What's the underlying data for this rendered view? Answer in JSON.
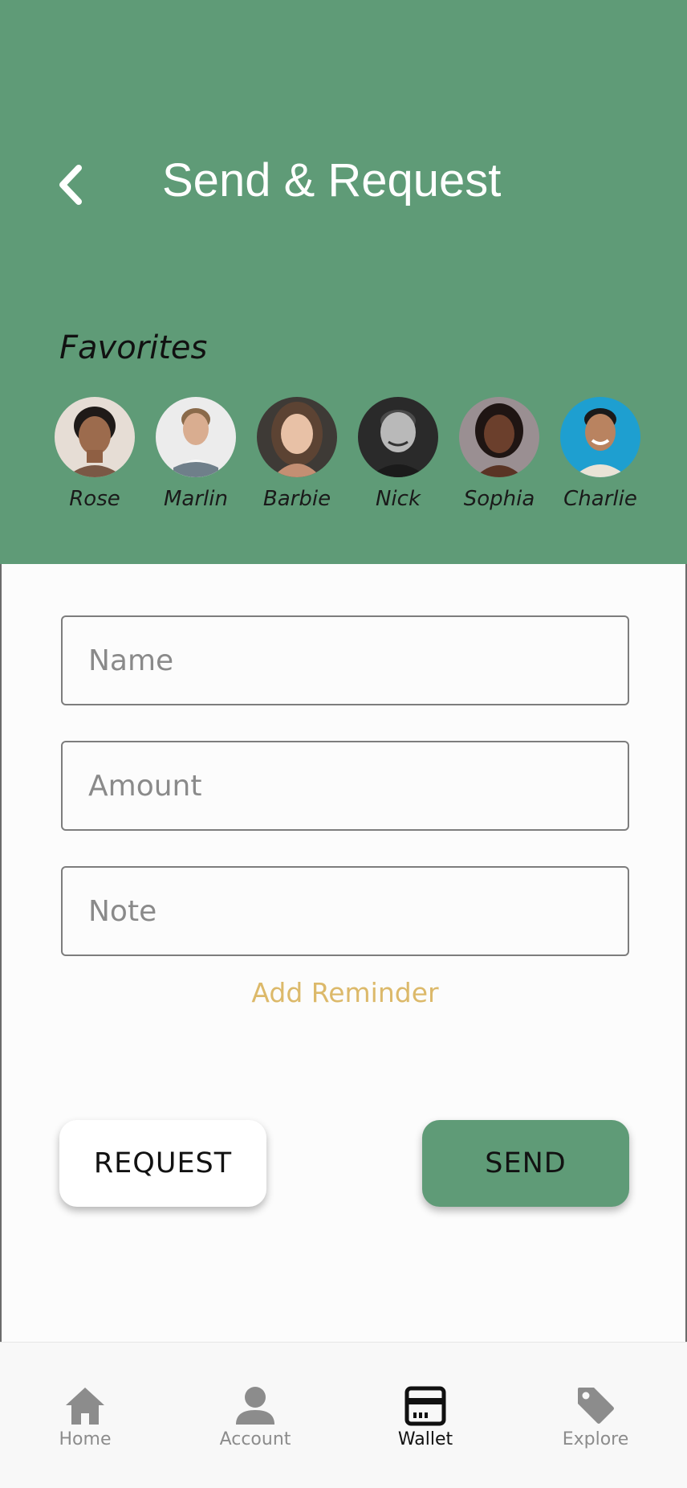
{
  "header": {
    "title": "Send & Request",
    "back_icon": "chevron-left-icon",
    "background_color": "#5f9b77"
  },
  "favorites": {
    "title": "Favorites",
    "people": [
      {
        "name": "Rose"
      },
      {
        "name": "Marlin"
      },
      {
        "name": "Barbie"
      },
      {
        "name": "Nick"
      },
      {
        "name": "Sophia"
      },
      {
        "name": "Charlie"
      }
    ]
  },
  "form": {
    "name_placeholder": "Name",
    "amount_placeholder": "Amount",
    "note_placeholder": "Note",
    "add_reminder_label": "Add Reminder",
    "reminder_color": "#dcb96a"
  },
  "actions": {
    "request_label": "REQUEST",
    "send_label": "SEND"
  },
  "bottom_nav": {
    "items": [
      {
        "label": "Home",
        "icon": "home-icon"
      },
      {
        "label": "Account",
        "icon": "user-icon"
      },
      {
        "label": "Wallet",
        "icon": "wallet-card-icon",
        "active": true
      },
      {
        "label": "Explore",
        "icon": "tag-icon"
      }
    ]
  }
}
